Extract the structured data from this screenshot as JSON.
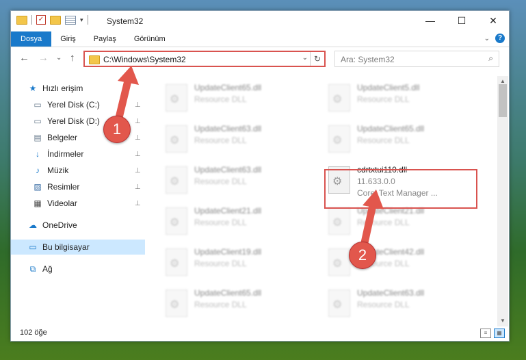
{
  "window": {
    "title": "System32",
    "min_label": "—",
    "max_label": "☐",
    "close_label": "✕"
  },
  "ribbon": {
    "tabs": [
      "Dosya",
      "Giriş",
      "Paylaş",
      "Görünüm"
    ],
    "collapse_chevron": "⌄",
    "help_label": "?"
  },
  "navbar": {
    "back_glyph": "←",
    "forward_glyph": "→",
    "recent_glyph": "⌄",
    "up_glyph": "↑",
    "address": "C:\\Windows\\System32",
    "address_dropdown_glyph": "⌄",
    "refresh_glyph": "↻",
    "search_placeholder": "Ara: System32",
    "search_glyph": "⌕"
  },
  "sidebar": {
    "items": [
      {
        "label": "Hızlı erişim",
        "icon": "star-icon",
        "glyph": "★",
        "color": "#1979ca",
        "pinned": false,
        "selected": false,
        "indent": 1
      },
      {
        "label": "Yerel Disk (C:)",
        "icon": "drive-icon",
        "glyph": "▭",
        "color": "#6b7d8e",
        "pinned": true,
        "selected": false,
        "indent": 2
      },
      {
        "label": "Yerel Disk (D:)",
        "icon": "drive-icon",
        "glyph": "▭",
        "color": "#6b7d8e",
        "pinned": true,
        "selected": false,
        "indent": 2
      },
      {
        "label": "Belgeler",
        "icon": "documents-icon",
        "glyph": "▤",
        "color": "#6b7d8e",
        "pinned": true,
        "selected": false,
        "indent": 2
      },
      {
        "label": "İndirmeler",
        "icon": "download-icon",
        "glyph": "↓",
        "color": "#1979ca",
        "pinned": true,
        "selected": false,
        "indent": 2
      },
      {
        "label": "Müzik",
        "icon": "music-icon",
        "glyph": "♪",
        "color": "#1979ca",
        "pinned": true,
        "selected": false,
        "indent": 2
      },
      {
        "label": "Resimler",
        "icon": "pictures-icon",
        "glyph": "▨",
        "color": "#3b6ea5",
        "pinned": true,
        "selected": false,
        "indent": 2
      },
      {
        "label": "Videolar",
        "icon": "video-icon",
        "glyph": "▦",
        "color": "#444444",
        "pinned": true,
        "selected": false,
        "indent": 2
      },
      {
        "label": "OneDrive",
        "icon": "cloud-icon",
        "glyph": "☁",
        "color": "#1979ca",
        "pinned": false,
        "selected": false,
        "indent": 1
      },
      {
        "label": "Bu bilgisayar",
        "icon": "computer-icon",
        "glyph": "▭",
        "color": "#1979ca",
        "pinned": false,
        "selected": true,
        "indent": 1
      },
      {
        "label": "Ağ",
        "icon": "network-icon",
        "glyph": "⧉",
        "color": "#1979ca",
        "pinned": false,
        "selected": false,
        "indent": 1
      }
    ],
    "pin_glyph": "📌"
  },
  "files": [
    {
      "name": "UpdateClient65.dll",
      "sub": "Resource DLL",
      "sub2": "",
      "blurred": true,
      "column": 0,
      "row": 0
    },
    {
      "name": "UpdateClient5.dll",
      "sub": "Resource DLL",
      "sub2": "",
      "blurred": true,
      "column": 1,
      "row": 0
    },
    {
      "name": "UpdateClient63.dll",
      "sub": "Resource DLL",
      "sub2": "",
      "blurred": true,
      "column": 0,
      "row": 1
    },
    {
      "name": "UpdateClient65.dll",
      "sub": "Resource DLL",
      "sub2": "",
      "blurred": true,
      "column": 1,
      "row": 1
    },
    {
      "name": "UpdateClient63.dll",
      "sub": "Resource DLL",
      "sub2": "",
      "blurred": true,
      "column": 0,
      "row": 2
    },
    {
      "name": "cdrtxtui110.dll",
      "sub": "11.633.0.0",
      "sub2": "Corel Text Manager ...",
      "blurred": false,
      "column": 1,
      "row": 2
    },
    {
      "name": "UpdateClient21.dll",
      "sub": "Resource DLL",
      "sub2": "",
      "blurred": true,
      "column": 0,
      "row": 3
    },
    {
      "name": "UpdateClient21.dll",
      "sub": "Resource DLL",
      "sub2": "",
      "blurred": true,
      "column": 1,
      "row": 3
    },
    {
      "name": "UpdateClient19.dll",
      "sub": "Resource DLL",
      "sub2": "",
      "blurred": true,
      "column": 0,
      "row": 4
    },
    {
      "name": "UpdateClient42.dll",
      "sub": "Resource DLL",
      "sub2": "",
      "blurred": true,
      "column": 1,
      "row": 4
    },
    {
      "name": "UpdateClient65.dll",
      "sub": "Resource DLL",
      "sub2": "",
      "blurred": true,
      "column": 0,
      "row": 5
    },
    {
      "name": "UpdateClient63.dll",
      "sub": "Resource DLL",
      "sub2": "",
      "blurred": true,
      "column": 1,
      "row": 5
    }
  ],
  "status": {
    "item_count": "102 öğe"
  },
  "annotations": {
    "step1": "1",
    "step2": "2",
    "color": "#e2574c"
  }
}
